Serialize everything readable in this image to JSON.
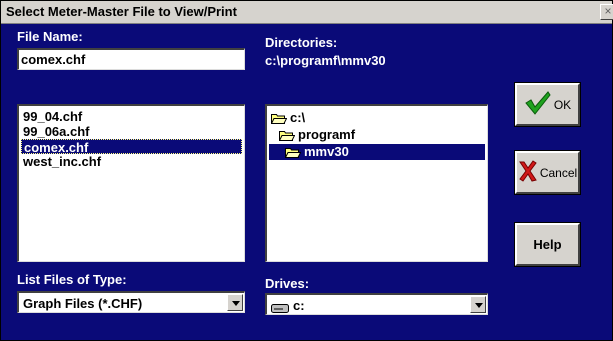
{
  "window": {
    "title": "Select Meter-Master File to View/Print",
    "close": "×"
  },
  "file": {
    "label": "File Name:",
    "value": "comex.chf",
    "items": [
      "99_04.chf",
      "99_06a.chf",
      "comex.chf",
      "west_inc.chf"
    ],
    "selected_index": 2
  },
  "dirs": {
    "label": "Directories:",
    "path": "c:\\programf\\mmv30",
    "items": [
      "c:\\",
      "programf",
      "mmv30"
    ],
    "selected_index": 2
  },
  "types": {
    "label": "List Files of Type:",
    "value": "Graph Files (*.CHF)"
  },
  "drives": {
    "label": "Drives:",
    "value": "c:"
  },
  "buttons": {
    "ok": "OK",
    "cancel": "Cancel",
    "help": "Help"
  },
  "colors": {
    "background": "#0a0a78",
    "face": "#d6d3ce",
    "selection": "#0a0a78"
  }
}
